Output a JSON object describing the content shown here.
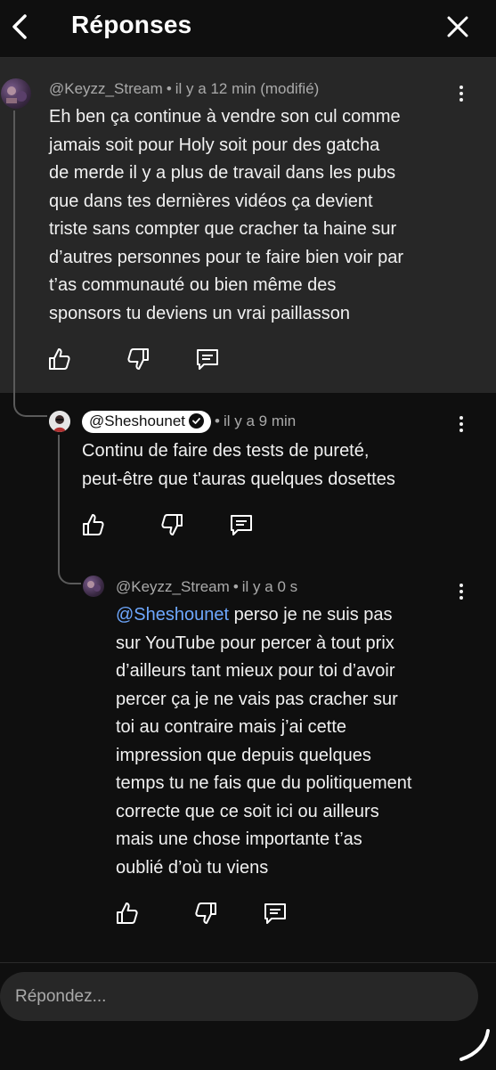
{
  "header": {
    "title": "Réponses"
  },
  "comments": [
    {
      "handle": "@Keyzz_Stream",
      "time": "il y a 12 min (modifié)",
      "lines": [
        "Eh ben ça continue à vendre son cul comme",
        "jamais soit pour  Holy soit pour des gatcha",
        "de merde il y a plus de travail dans les pubs",
        "que dans tes dernières vidéos ça devient",
        "triste sans compter que cracher ta haine sur",
        "d’autres personnes pour te faire bien voir par",
        "t’as communauté ou bien même des",
        "sponsors tu deviens un vrai paillasson"
      ]
    },
    {
      "handle": "@Sheshounet",
      "verified": true,
      "time": "il y a 9 min",
      "lines": [
        "Continu de faire des tests de pureté,",
        "peut-être que t'auras quelques dosettes"
      ]
    },
    {
      "handle": "@Keyzz_Stream",
      "time": "il y a 0 s",
      "mention": "@Sheshounet",
      "first_line_rest": "perso je ne suis pas",
      "lines": [
        "sur YouTube pour percer à tout prix",
        "d’ailleurs tant mieux pour toi d’avoir",
        "percer ça je ne vais pas cracher sur",
        "toi au contraire mais j’ai cette",
        "impression que depuis quelques",
        "temps tu ne fais que du politiquement",
        "correcte que ce soit ici ou ailleurs",
        "mais une chose importante t’as",
        "oublié d’où tu viens"
      ]
    }
  ],
  "reply_input": {
    "placeholder": "Répondez..."
  },
  "icons": {
    "back": "chevron-left-icon",
    "close": "close-icon",
    "like": "thumbs-up-icon",
    "dislike": "thumbs-down-icon",
    "reply": "comment-icon",
    "more": "more-vert-icon"
  },
  "colors": {
    "background": "#0f0f0f",
    "highlight": "#272727",
    "mention": "#6ea8ff"
  }
}
